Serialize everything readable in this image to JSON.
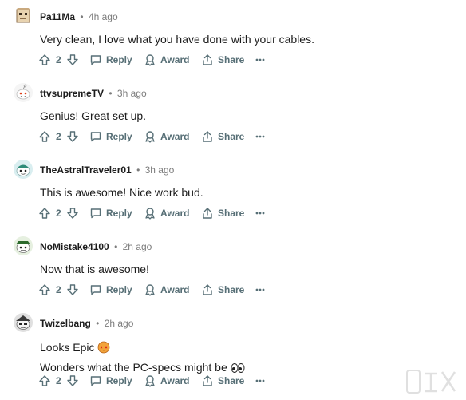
{
  "comments": [
    {
      "username": "Pa11Ma",
      "time": "4h ago",
      "lines": [
        "Very clean, I love what you have done with your cables."
      ],
      "votes": "2",
      "reply_label": "Reply",
      "award_label": "Award",
      "share_label": "Share"
    },
    {
      "username": "ttvsupremeTV",
      "time": "3h ago",
      "lines": [
        "Genius! Great set up."
      ],
      "votes": "2",
      "reply_label": "Reply",
      "award_label": "Award",
      "share_label": "Share"
    },
    {
      "username": "TheAstralTraveler01",
      "time": "3h ago",
      "lines": [
        "This is awesome! Nice work bud."
      ],
      "votes": "2",
      "reply_label": "Reply",
      "award_label": "Award",
      "share_label": "Share"
    },
    {
      "username": "NoMistake4100",
      "time": "2h ago",
      "lines": [
        "Now that is awesome!"
      ],
      "votes": "2",
      "reply_label": "Reply",
      "award_label": "Award",
      "share_label": "Share"
    },
    {
      "username": "Twizelbang",
      "time": "2h ago",
      "lines": [
        "Looks Epic",
        "Wonders what the PC-specs might be"
      ],
      "votes": "2",
      "reply_label": "Reply",
      "award_label": "Award",
      "share_label": "Share"
    }
  ],
  "separator": "•",
  "icons": {
    "upvote": "upvote-arrow-icon",
    "downvote": "downvote-arrow-icon",
    "reply": "comment-bubble-icon",
    "award": "award-ribbon-icon",
    "share": "share-upload-icon",
    "more": "more-dots-icon"
  },
  "colors": {
    "text": "#1c1c1c",
    "muted": "#7c7c7c",
    "action": "#576f76"
  }
}
